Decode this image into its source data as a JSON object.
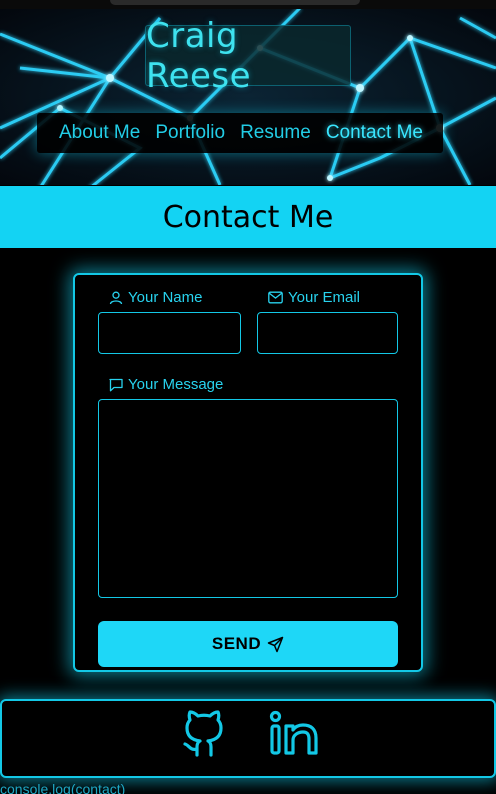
{
  "header": {
    "name": "Craig Reese",
    "nav": [
      {
        "label": "About Me",
        "active": false
      },
      {
        "label": "Portfolio",
        "active": false
      },
      {
        "label": "Resume",
        "active": false
      },
      {
        "label": "Contact Me",
        "active": true
      }
    ]
  },
  "section": {
    "title": "Contact Me"
  },
  "form": {
    "name_label": "Your Name",
    "name_value": "",
    "email_label": "Your Email",
    "email_value": "",
    "message_label": "Your Message",
    "message_value": "",
    "send_label": "SEND",
    "icons": {
      "name": "user-icon",
      "email": "mail-icon",
      "message": "message-icon",
      "send": "send-icon"
    }
  },
  "footer": {
    "links": [
      {
        "icon": "github-icon"
      },
      {
        "icon": "linkedin-icon"
      }
    ]
  },
  "console_text": "console.log(contact)",
  "colors": {
    "accent": "#13d3f3",
    "background": "#000000",
    "text_accent": "#28d2ee"
  }
}
